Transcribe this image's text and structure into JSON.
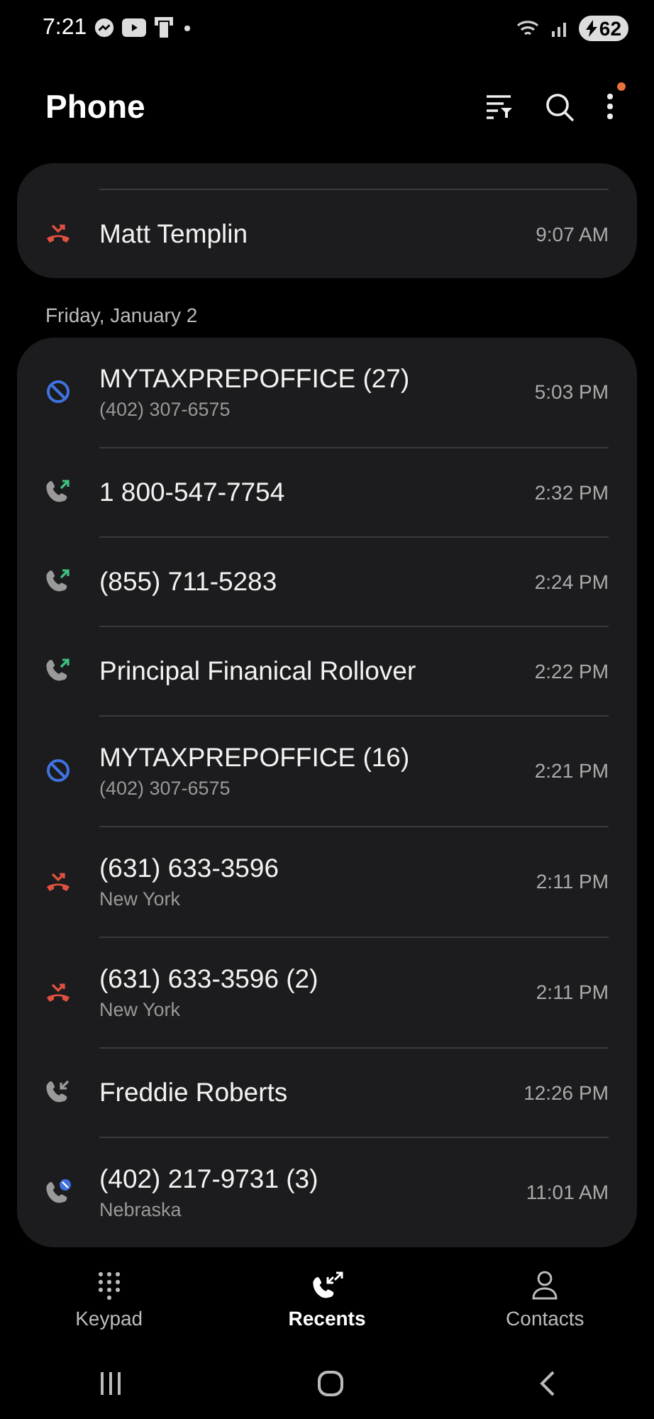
{
  "status_bar": {
    "time": "7:21",
    "battery": "62"
  },
  "header": {
    "title": "Phone",
    "notification_dot": true
  },
  "sections": [
    {
      "calls": [
        {
          "kind": "missed",
          "name": "Matt Templin",
          "time": "9:07 AM"
        }
      ]
    },
    {
      "date": "Friday, January 2",
      "calls": [
        {
          "kind": "blocked",
          "name": "MYTAXPREPOFFICE (27)",
          "detail": "(402) 307-6575",
          "time": "5:03 PM"
        },
        {
          "kind": "outgoing",
          "name": "1 800-547-7754",
          "time": "2:32 PM"
        },
        {
          "kind": "outgoing",
          "name": "(855) 711-5283",
          "time": "2:24 PM"
        },
        {
          "kind": "outgoing",
          "name": "Principal Finanical Rollover",
          "time": "2:22 PM"
        },
        {
          "kind": "blocked",
          "name": "MYTAXPREPOFFICE (16)",
          "detail": "(402) 307-6575",
          "time": "2:21 PM"
        },
        {
          "kind": "missed",
          "name": "(631) 633-3596",
          "detail": "New York",
          "time": "2:11 PM"
        },
        {
          "kind": "missed",
          "name": "(631) 633-3596 (2)",
          "detail": "New York",
          "time": "2:11 PM"
        },
        {
          "kind": "incoming",
          "name": "Freddie Roberts",
          "time": "12:26 PM"
        },
        {
          "kind": "rejected",
          "name": "(402) 217-9731 (3)",
          "detail": "Nebraska",
          "time": "11:01 AM"
        }
      ]
    }
  ],
  "tabs": [
    {
      "label": "Keypad",
      "kind": "keypad",
      "selected": false
    },
    {
      "label": "Recents",
      "kind": "recents",
      "selected": true
    },
    {
      "label": "Contacts",
      "kind": "contacts",
      "selected": false
    }
  ]
}
